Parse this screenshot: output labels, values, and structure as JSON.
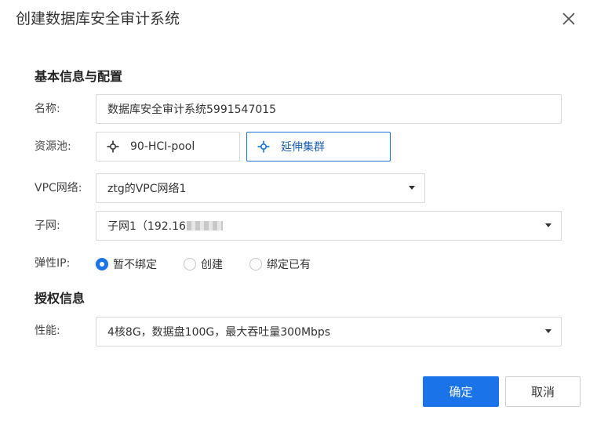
{
  "dialog": {
    "title": "创建数据库安全审计系统"
  },
  "basic": {
    "section_title": "基本信息与配置",
    "name_label": "名称:",
    "name_value": "数据库安全审计系统5991547015",
    "pool_label": "资源池:",
    "pools": [
      {
        "label": "90-HCI-pool",
        "icon": "cluster-icon",
        "selected": false
      },
      {
        "label": "延伸集群",
        "icon": "cluster-icon",
        "selected": true
      }
    ],
    "vpc_label": "VPC网络:",
    "vpc_value": "ztg的VPC网络1",
    "subnet_label": "子网:",
    "subnet_value": "子网1（192.16",
    "eip_label": "弹性IP:",
    "eip_options": [
      {
        "label": "暂不绑定",
        "checked": true
      },
      {
        "label": "创建",
        "checked": false
      },
      {
        "label": "绑定已有",
        "checked": false
      }
    ]
  },
  "license": {
    "section_title": "授权信息",
    "perf_label": "性能:",
    "perf_value": "4核8G，数据盘100G，最大吞吐量300Mbps"
  },
  "footer": {
    "confirm_label": "确定",
    "cancel_label": "取消"
  },
  "colors": {
    "primary": "#1a73e8",
    "border": "#d9d9d9",
    "text": "#333333"
  }
}
